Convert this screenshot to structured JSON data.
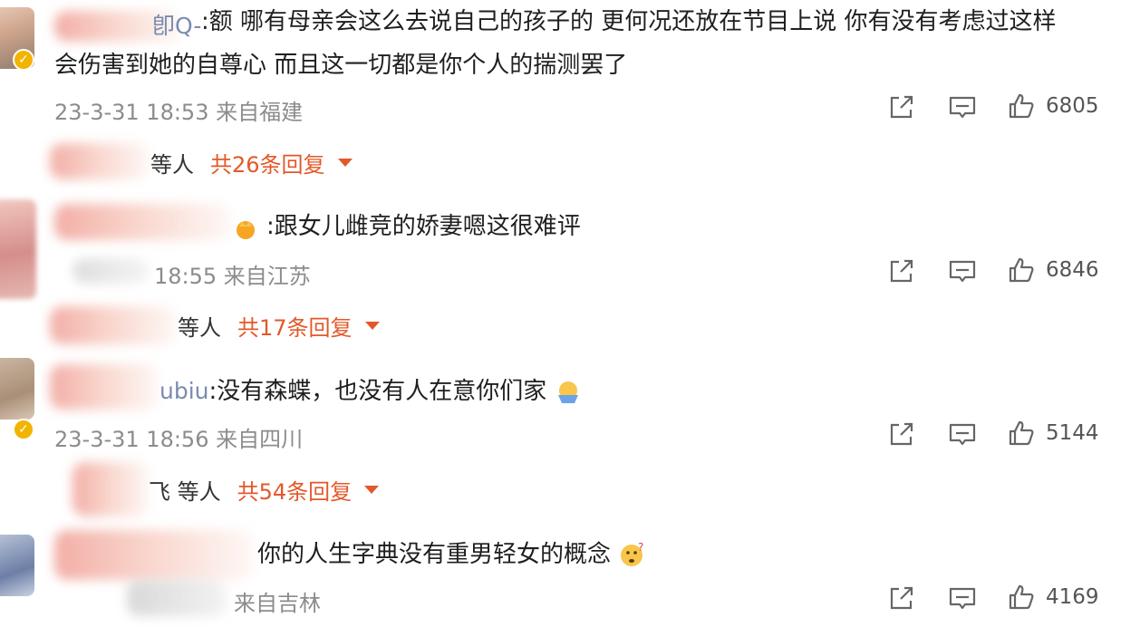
{
  "comments": [
    {
      "name_fragment": "卽Q-",
      "text_line1": ":额 哪有母亲会这么去说自己的孩子的 更何况还放在节目上说 你有没有考虑过这样",
      "text_line2": "会伤害到她的自尊心 而且这一切都是你个人的揣测罢了",
      "date": "23-3-31 18:53 来自福建",
      "likes": "6805",
      "reply_who": "等人",
      "reply_total": "共26条回复"
    },
    {
      "name_fragment": "",
      "text_line1": ":跟女儿雌竞的娇妻嗯这很难评",
      "date": "18:55 来自江苏",
      "likes": "6846",
      "reply_who": "等人",
      "reply_total": "共17条回复"
    },
    {
      "name_fragment": "ubiu",
      "text_line1": ":没有森蝶，也没有人在意你们家",
      "date": "23-3-31 18:56 来自四川",
      "likes": "5144",
      "reply_who": "飞 等人",
      "reply_total": "共54条回复"
    },
    {
      "name_fragment": "",
      "text_line1": "你的人生字典没有重男轻女的概念",
      "date": "来自吉林",
      "likes": "4169"
    }
  ],
  "icons": {
    "share": "share-icon",
    "comment": "comment-icon",
    "like": "like-icon",
    "dropdown": "chevron-down-icon"
  },
  "colors": {
    "accent": "#e3582a",
    "meta": "#8c8c8c",
    "name": "#7a8bb0"
  }
}
